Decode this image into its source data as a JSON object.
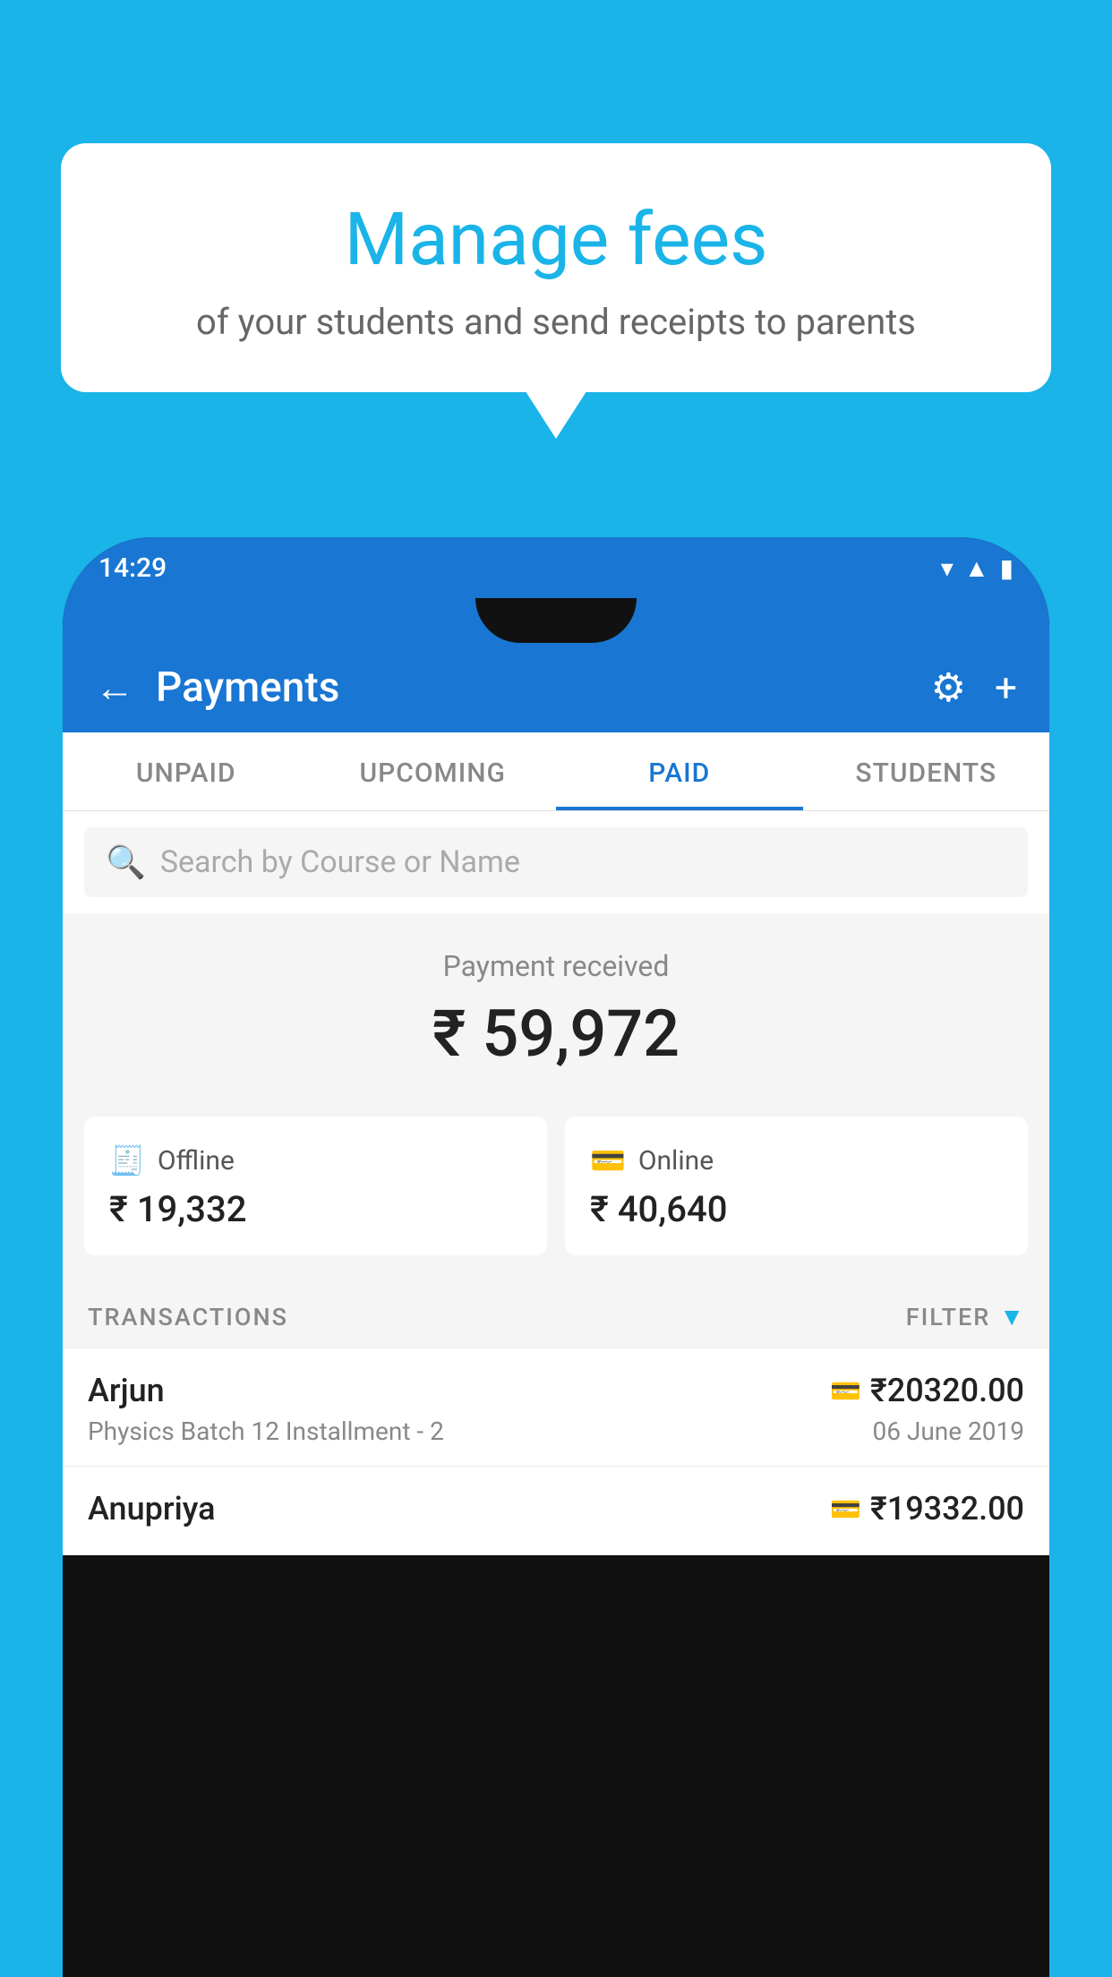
{
  "background_color": "#1ab4e8",
  "speech_bubble": {
    "title": "Manage fees",
    "subtitle": "of your students and send receipts to parents"
  },
  "status_bar": {
    "time": "14:29",
    "icons": [
      "wifi",
      "signal",
      "battery"
    ]
  },
  "header": {
    "back_label": "←",
    "title": "Payments",
    "settings_icon": "⚙",
    "add_icon": "+"
  },
  "tabs": [
    {
      "label": "UNPAID",
      "active": false
    },
    {
      "label": "UPCOMING",
      "active": false
    },
    {
      "label": "PAID",
      "active": true
    },
    {
      "label": "STUDENTS",
      "active": false
    }
  ],
  "search": {
    "placeholder": "Search by Course or Name"
  },
  "payment_received": {
    "label": "Payment received",
    "amount": "₹ 59,972"
  },
  "offline_payment": {
    "icon": "📤",
    "label": "Offline",
    "amount": "₹ 19,332"
  },
  "online_payment": {
    "icon": "💳",
    "label": "Online",
    "amount": "₹ 40,640"
  },
  "transactions_section": {
    "label": "TRANSACTIONS",
    "filter_label": "FILTER",
    "filter_icon": "▼"
  },
  "transactions": [
    {
      "name": "Arjun",
      "mode_icon": "💳",
      "amount": "₹20320.00",
      "course": "Physics Batch 12 Installment - 2",
      "date": "06 June 2019"
    },
    {
      "name": "Anupriya",
      "mode_icon": "📤",
      "amount": "₹19332.00",
      "course": "",
      "date": ""
    }
  ]
}
